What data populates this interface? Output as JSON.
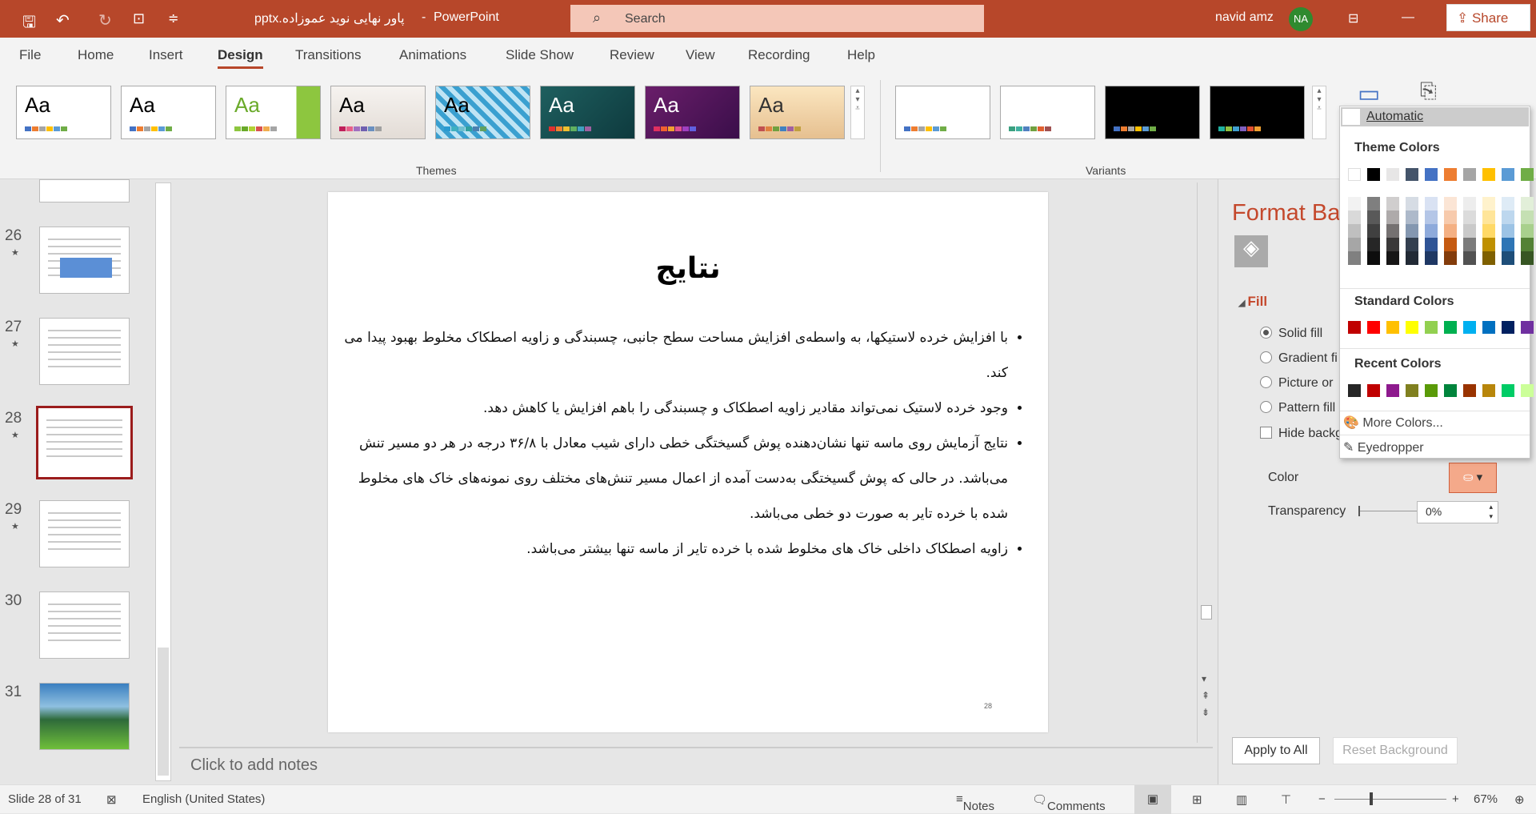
{
  "titlebar": {
    "filename": "پاور نهایی نوید عموزاده.pptx",
    "sep": "-",
    "app": "PowerPoint",
    "search_placeholder": "Search",
    "user": "navid amz",
    "initials": "NA"
  },
  "tabs": [
    {
      "label": "File"
    },
    {
      "label": "Home"
    },
    {
      "label": "Insert"
    },
    {
      "label": "Design",
      "active": true
    },
    {
      "label": "Transitions"
    },
    {
      "label": "Animations"
    },
    {
      "label": "Slide Show"
    },
    {
      "label": "Review"
    },
    {
      "label": "View"
    },
    {
      "label": "Recording"
    },
    {
      "label": "Help"
    }
  ],
  "share_label": "Share",
  "themes": {
    "label": "Themes",
    "items": [
      {
        "bg": "#ffffff",
        "fg": "#000",
        "bars": [
          "#4472c4",
          "#ed7d31",
          "#a5a5a5",
          "#ffc000",
          "#5b9bd5",
          "#70ad47"
        ]
      },
      {
        "bg": "#ffffff",
        "fg": "#000",
        "bars": [
          "#4472c4",
          "#ed7d31",
          "#a5a5a5",
          "#ffc000",
          "#5b9bd5",
          "#70ad47"
        ]
      },
      {
        "bg": "linear-gradient(90deg,#fff 75%,#8dc63f 75%)",
        "fg": "#6aaa2a",
        "bars": [
          "#8dc63f",
          "#6aaa2a",
          "#b2d235",
          "#d9534f",
          "#f0ad4e",
          "#a5a5a5"
        ]
      },
      {
        "bg": "linear-gradient(#f6f3f0,#e3dcd6)",
        "fg": "#000",
        "bars": [
          "#c0205a",
          "#e8608a",
          "#a070c0",
          "#7060b0",
          "#6a90c0",
          "#a0a0a0"
        ]
      },
      {
        "bg": "repeating-linear-gradient(45deg,#3aa0d0 0 6px,#bfe4f4 6px 12px)",
        "fg": "#000",
        "bars": [
          "#2a9ad0",
          "#40b0c0",
          "#70c0d0",
          "#30a0a0",
          "#4a80b0",
          "#60a060"
        ]
      },
      {
        "bg": "linear-gradient(135deg,#1e5f5f,#0e3a3e)",
        "fg": "#fff",
        "bars": [
          "#e03030",
          "#f08030",
          "#f0c030",
          "#60b060",
          "#40a0c0",
          "#a060a0"
        ]
      },
      {
        "bg": "linear-gradient(135deg,#6a1e6a,#3a0e4a)",
        "fg": "#fff",
        "bars": [
          "#e03060",
          "#f06030",
          "#f0a030",
          "#e05090",
          "#a040c0",
          "#6060e0"
        ]
      },
      {
        "bg": "linear-gradient(#fbe6c0,#e6c090)",
        "fg": "#333",
        "bars": [
          "#c05050",
          "#e08040",
          "#70a040",
          "#4080c0",
          "#a060a0",
          "#c0a040"
        ]
      }
    ]
  },
  "variants": {
    "label": "Variants",
    "items": [
      {
        "bg": "#ffffff",
        "bars": [
          "#4472c4",
          "#ed7d31",
          "#a5a5a5",
          "#ffc000",
          "#5b9bd5",
          "#70ad47"
        ]
      },
      {
        "bg": "#ffffff",
        "bars": [
          "#3aa080",
          "#40b0a0",
          "#5080c0",
          "#70a040",
          "#e06030",
          "#a05050"
        ]
      },
      {
        "bg": "#000000",
        "bars": [
          "#4472c4",
          "#ed7d31",
          "#a5a5a5",
          "#ffc000",
          "#5b9bd5",
          "#70ad47"
        ]
      },
      {
        "bg": "#000000",
        "bars": [
          "#20b0a0",
          "#90c040",
          "#40a0d0",
          "#8060c0",
          "#e05030",
          "#f0a030"
        ]
      }
    ]
  },
  "slides": [
    {
      "num": "26",
      "starred": true
    },
    {
      "num": "27",
      "starred": true
    },
    {
      "num": "28",
      "starred": true,
      "selected": true
    },
    {
      "num": "29",
      "starred": true
    },
    {
      "num": "30",
      "starred": false
    },
    {
      "num": "31",
      "starred": false
    }
  ],
  "slide": {
    "title": "نتایج",
    "bullets": [
      "با افزایش خرده لاستیکها، به واسطه‌ی افزایش مساحت سطح جانبی، چسبندگی و زاویه اصطکاک مخلوط بهبود پیدا می کند.",
      "وجود خرده لاستیک نمی‌تواند مقادیر زاویه اصطکاک و چسبندگی را باهم افزایش یا کاهش دهد.",
      "نتایج آزمایش روی ماسه تنها نشان‌دهنده پوش گسیختگی خطی دارای شیب معادل با ۳۶/۸ درجه در هر دو مسیر تنش می‌باشد. در حالی که پوش گسیختگی به‌دست آمده از اعمال مسیر تنش‌های مختلف روی نمونه‌های خاک های مخلوط شده با خرده تایر به صورت دو خطی می‌باشد.",
      "زاویه اصطکاک داخلی خاک های مخلوط شده با خرده تایر از ماسه تنها بیشتر می‌باشد."
    ],
    "page_number": "28"
  },
  "notes_placeholder": "Click to add notes",
  "format_pane": {
    "title": "Format Ba",
    "section": "Fill",
    "options": [
      {
        "label": "Solid fill",
        "checked": true
      },
      {
        "label": "Gradient fi",
        "checked": false
      },
      {
        "label": "Picture or",
        "checked": false
      },
      {
        "label": "Pattern fill",
        "checked": false
      }
    ],
    "hide_label": "Hide backg",
    "color_label": "Color",
    "transparency_label": "Transparency",
    "transparency_value": "0%",
    "apply_all": "Apply to All",
    "reset": "Reset Background"
  },
  "color_menu": {
    "automatic": "Automatic",
    "theme_header": "Theme Colors",
    "standard_header": "Standard Colors",
    "recent_header": "Recent Colors",
    "more": "More Colors...",
    "eyedropper": "Eyedropper",
    "theme": [
      "#ffffff",
      "#000000",
      "#e7e6e6",
      "#44546a",
      "#4472c4",
      "#ed7d31",
      "#a5a5a5",
      "#ffc000",
      "#5b9bd5",
      "#70ad47"
    ],
    "shades": [
      [
        "#f2f2f2",
        "#d9d9d9",
        "#bfbfbf",
        "#a6a6a6",
        "#808080"
      ],
      [
        "#7f7f7f",
        "#595959",
        "#404040",
        "#262626",
        "#0d0d0d"
      ],
      [
        "#d0cece",
        "#aeaaaa",
        "#757171",
        "#3a3838",
        "#171616"
      ],
      [
        "#d6dce4",
        "#adb9ca",
        "#8497b0",
        "#333f4f",
        "#222a35"
      ],
      [
        "#d9e2f3",
        "#b4c6e7",
        "#8eaadb",
        "#2f5496",
        "#1f3864"
      ],
      [
        "#fbe5d5",
        "#f7caac",
        "#f4b083",
        "#c55a11",
        "#833c0b"
      ],
      [
        "#ededed",
        "#dbdbdb",
        "#c9c9c9",
        "#7b7b7b",
        "#525252"
      ],
      [
        "#fff2cc",
        "#ffe599",
        "#ffd966",
        "#bf9000",
        "#7f6000"
      ],
      [
        "#deebf6",
        "#bdd7ee",
        "#9cc3e5",
        "#2e75b5",
        "#1e4e79"
      ],
      [
        "#e2efd9",
        "#c5e0b3",
        "#a8d08d",
        "#538135",
        "#375623"
      ]
    ],
    "standard": [
      "#c00000",
      "#ff0000",
      "#ffc000",
      "#ffff00",
      "#92d050",
      "#00b050",
      "#00b0f0",
      "#0070c0",
      "#002060",
      "#7030a0"
    ],
    "recent": [
      "#262626",
      "#c00000",
      "#8e1a8e",
      "#808020",
      "#5a9a08",
      "#00843c",
      "#993300",
      "#b8860b",
      "#00cc66",
      "#ccff99"
    ]
  },
  "status": {
    "slide": "Slide 28 of 31",
    "language": "English (United States)",
    "notes": "Notes",
    "comments": "Comments",
    "zoom": "67%"
  },
  "accent": "#b7472a"
}
